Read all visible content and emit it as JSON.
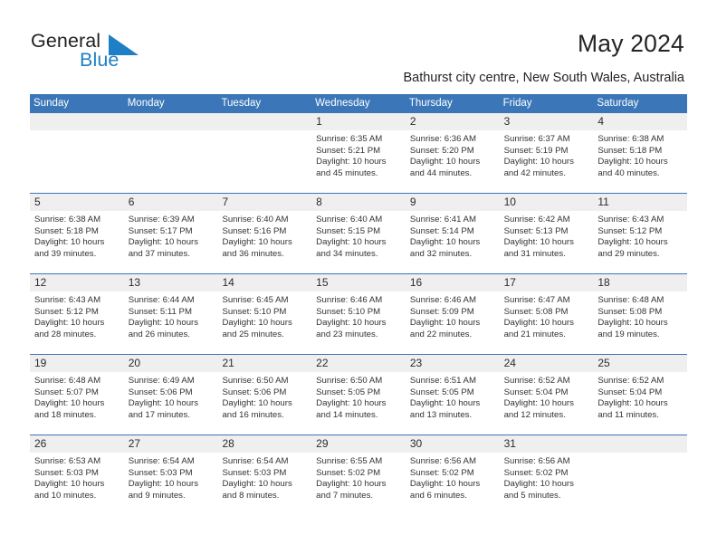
{
  "brand": {
    "name_top": "General",
    "name_bottom": "Blue",
    "color_dark": "#231f20",
    "color_blue": "#1f7fc4"
  },
  "header": {
    "title": "May 2024",
    "subtitle": "Bathurst city centre, New South Wales, Australia"
  },
  "theme": {
    "header_bg": "#3b77b8",
    "header_text": "#ffffff",
    "numbers_band_bg": "#efefef",
    "cell_bg": "#ffffff",
    "rule": "#3b77b8"
  },
  "calendar": {
    "weekday_headers": [
      "Sunday",
      "Monday",
      "Tuesday",
      "Wednesday",
      "Thursday",
      "Friday",
      "Saturday"
    ],
    "weeks": [
      {
        "days": [
          {
            "num": "",
            "sunrise": "",
            "sunset": "",
            "daylight_1": "",
            "daylight_2": ""
          },
          {
            "num": "",
            "sunrise": "",
            "sunset": "",
            "daylight_1": "",
            "daylight_2": ""
          },
          {
            "num": "",
            "sunrise": "",
            "sunset": "",
            "daylight_1": "",
            "daylight_2": ""
          },
          {
            "num": "1",
            "sunrise": "Sunrise: 6:35 AM",
            "sunset": "Sunset: 5:21 PM",
            "daylight_1": "Daylight: 10 hours",
            "daylight_2": "and 45 minutes."
          },
          {
            "num": "2",
            "sunrise": "Sunrise: 6:36 AM",
            "sunset": "Sunset: 5:20 PM",
            "daylight_1": "Daylight: 10 hours",
            "daylight_2": "and 44 minutes."
          },
          {
            "num": "3",
            "sunrise": "Sunrise: 6:37 AM",
            "sunset": "Sunset: 5:19 PM",
            "daylight_1": "Daylight: 10 hours",
            "daylight_2": "and 42 minutes."
          },
          {
            "num": "4",
            "sunrise": "Sunrise: 6:38 AM",
            "sunset": "Sunset: 5:18 PM",
            "daylight_1": "Daylight: 10 hours",
            "daylight_2": "and 40 minutes."
          }
        ]
      },
      {
        "days": [
          {
            "num": "5",
            "sunrise": "Sunrise: 6:38 AM",
            "sunset": "Sunset: 5:18 PM",
            "daylight_1": "Daylight: 10 hours",
            "daylight_2": "and 39 minutes."
          },
          {
            "num": "6",
            "sunrise": "Sunrise: 6:39 AM",
            "sunset": "Sunset: 5:17 PM",
            "daylight_1": "Daylight: 10 hours",
            "daylight_2": "and 37 minutes."
          },
          {
            "num": "7",
            "sunrise": "Sunrise: 6:40 AM",
            "sunset": "Sunset: 5:16 PM",
            "daylight_1": "Daylight: 10 hours",
            "daylight_2": "and 36 minutes."
          },
          {
            "num": "8",
            "sunrise": "Sunrise: 6:40 AM",
            "sunset": "Sunset: 5:15 PM",
            "daylight_1": "Daylight: 10 hours",
            "daylight_2": "and 34 minutes."
          },
          {
            "num": "9",
            "sunrise": "Sunrise: 6:41 AM",
            "sunset": "Sunset: 5:14 PM",
            "daylight_1": "Daylight: 10 hours",
            "daylight_2": "and 32 minutes."
          },
          {
            "num": "10",
            "sunrise": "Sunrise: 6:42 AM",
            "sunset": "Sunset: 5:13 PM",
            "daylight_1": "Daylight: 10 hours",
            "daylight_2": "and 31 minutes."
          },
          {
            "num": "11",
            "sunrise": "Sunrise: 6:43 AM",
            "sunset": "Sunset: 5:12 PM",
            "daylight_1": "Daylight: 10 hours",
            "daylight_2": "and 29 minutes."
          }
        ]
      },
      {
        "days": [
          {
            "num": "12",
            "sunrise": "Sunrise: 6:43 AM",
            "sunset": "Sunset: 5:12 PM",
            "daylight_1": "Daylight: 10 hours",
            "daylight_2": "and 28 minutes."
          },
          {
            "num": "13",
            "sunrise": "Sunrise: 6:44 AM",
            "sunset": "Sunset: 5:11 PM",
            "daylight_1": "Daylight: 10 hours",
            "daylight_2": "and 26 minutes."
          },
          {
            "num": "14",
            "sunrise": "Sunrise: 6:45 AM",
            "sunset": "Sunset: 5:10 PM",
            "daylight_1": "Daylight: 10 hours",
            "daylight_2": "and 25 minutes."
          },
          {
            "num": "15",
            "sunrise": "Sunrise: 6:46 AM",
            "sunset": "Sunset: 5:10 PM",
            "daylight_1": "Daylight: 10 hours",
            "daylight_2": "and 23 minutes."
          },
          {
            "num": "16",
            "sunrise": "Sunrise: 6:46 AM",
            "sunset": "Sunset: 5:09 PM",
            "daylight_1": "Daylight: 10 hours",
            "daylight_2": "and 22 minutes."
          },
          {
            "num": "17",
            "sunrise": "Sunrise: 6:47 AM",
            "sunset": "Sunset: 5:08 PM",
            "daylight_1": "Daylight: 10 hours",
            "daylight_2": "and 21 minutes."
          },
          {
            "num": "18",
            "sunrise": "Sunrise: 6:48 AM",
            "sunset": "Sunset: 5:08 PM",
            "daylight_1": "Daylight: 10 hours",
            "daylight_2": "and 19 minutes."
          }
        ]
      },
      {
        "days": [
          {
            "num": "19",
            "sunrise": "Sunrise: 6:48 AM",
            "sunset": "Sunset: 5:07 PM",
            "daylight_1": "Daylight: 10 hours",
            "daylight_2": "and 18 minutes."
          },
          {
            "num": "20",
            "sunrise": "Sunrise: 6:49 AM",
            "sunset": "Sunset: 5:06 PM",
            "daylight_1": "Daylight: 10 hours",
            "daylight_2": "and 17 minutes."
          },
          {
            "num": "21",
            "sunrise": "Sunrise: 6:50 AM",
            "sunset": "Sunset: 5:06 PM",
            "daylight_1": "Daylight: 10 hours",
            "daylight_2": "and 16 minutes."
          },
          {
            "num": "22",
            "sunrise": "Sunrise: 6:50 AM",
            "sunset": "Sunset: 5:05 PM",
            "daylight_1": "Daylight: 10 hours",
            "daylight_2": "and 14 minutes."
          },
          {
            "num": "23",
            "sunrise": "Sunrise: 6:51 AM",
            "sunset": "Sunset: 5:05 PM",
            "daylight_1": "Daylight: 10 hours",
            "daylight_2": "and 13 minutes."
          },
          {
            "num": "24",
            "sunrise": "Sunrise: 6:52 AM",
            "sunset": "Sunset: 5:04 PM",
            "daylight_1": "Daylight: 10 hours",
            "daylight_2": "and 12 minutes."
          },
          {
            "num": "25",
            "sunrise": "Sunrise: 6:52 AM",
            "sunset": "Sunset: 5:04 PM",
            "daylight_1": "Daylight: 10 hours",
            "daylight_2": "and 11 minutes."
          }
        ]
      },
      {
        "days": [
          {
            "num": "26",
            "sunrise": "Sunrise: 6:53 AM",
            "sunset": "Sunset: 5:03 PM",
            "daylight_1": "Daylight: 10 hours",
            "daylight_2": "and 10 minutes."
          },
          {
            "num": "27",
            "sunrise": "Sunrise: 6:54 AM",
            "sunset": "Sunset: 5:03 PM",
            "daylight_1": "Daylight: 10 hours",
            "daylight_2": "and 9 minutes."
          },
          {
            "num": "28",
            "sunrise": "Sunrise: 6:54 AM",
            "sunset": "Sunset: 5:03 PM",
            "daylight_1": "Daylight: 10 hours",
            "daylight_2": "and 8 minutes."
          },
          {
            "num": "29",
            "sunrise": "Sunrise: 6:55 AM",
            "sunset": "Sunset: 5:02 PM",
            "daylight_1": "Daylight: 10 hours",
            "daylight_2": "and 7 minutes."
          },
          {
            "num": "30",
            "sunrise": "Sunrise: 6:56 AM",
            "sunset": "Sunset: 5:02 PM",
            "daylight_1": "Daylight: 10 hours",
            "daylight_2": "and 6 minutes."
          },
          {
            "num": "31",
            "sunrise": "Sunrise: 6:56 AM",
            "sunset": "Sunset: 5:02 PM",
            "daylight_1": "Daylight: 10 hours",
            "daylight_2": "and 5 minutes."
          },
          {
            "num": "",
            "sunrise": "",
            "sunset": "",
            "daylight_1": "",
            "daylight_2": ""
          }
        ]
      }
    ]
  }
}
